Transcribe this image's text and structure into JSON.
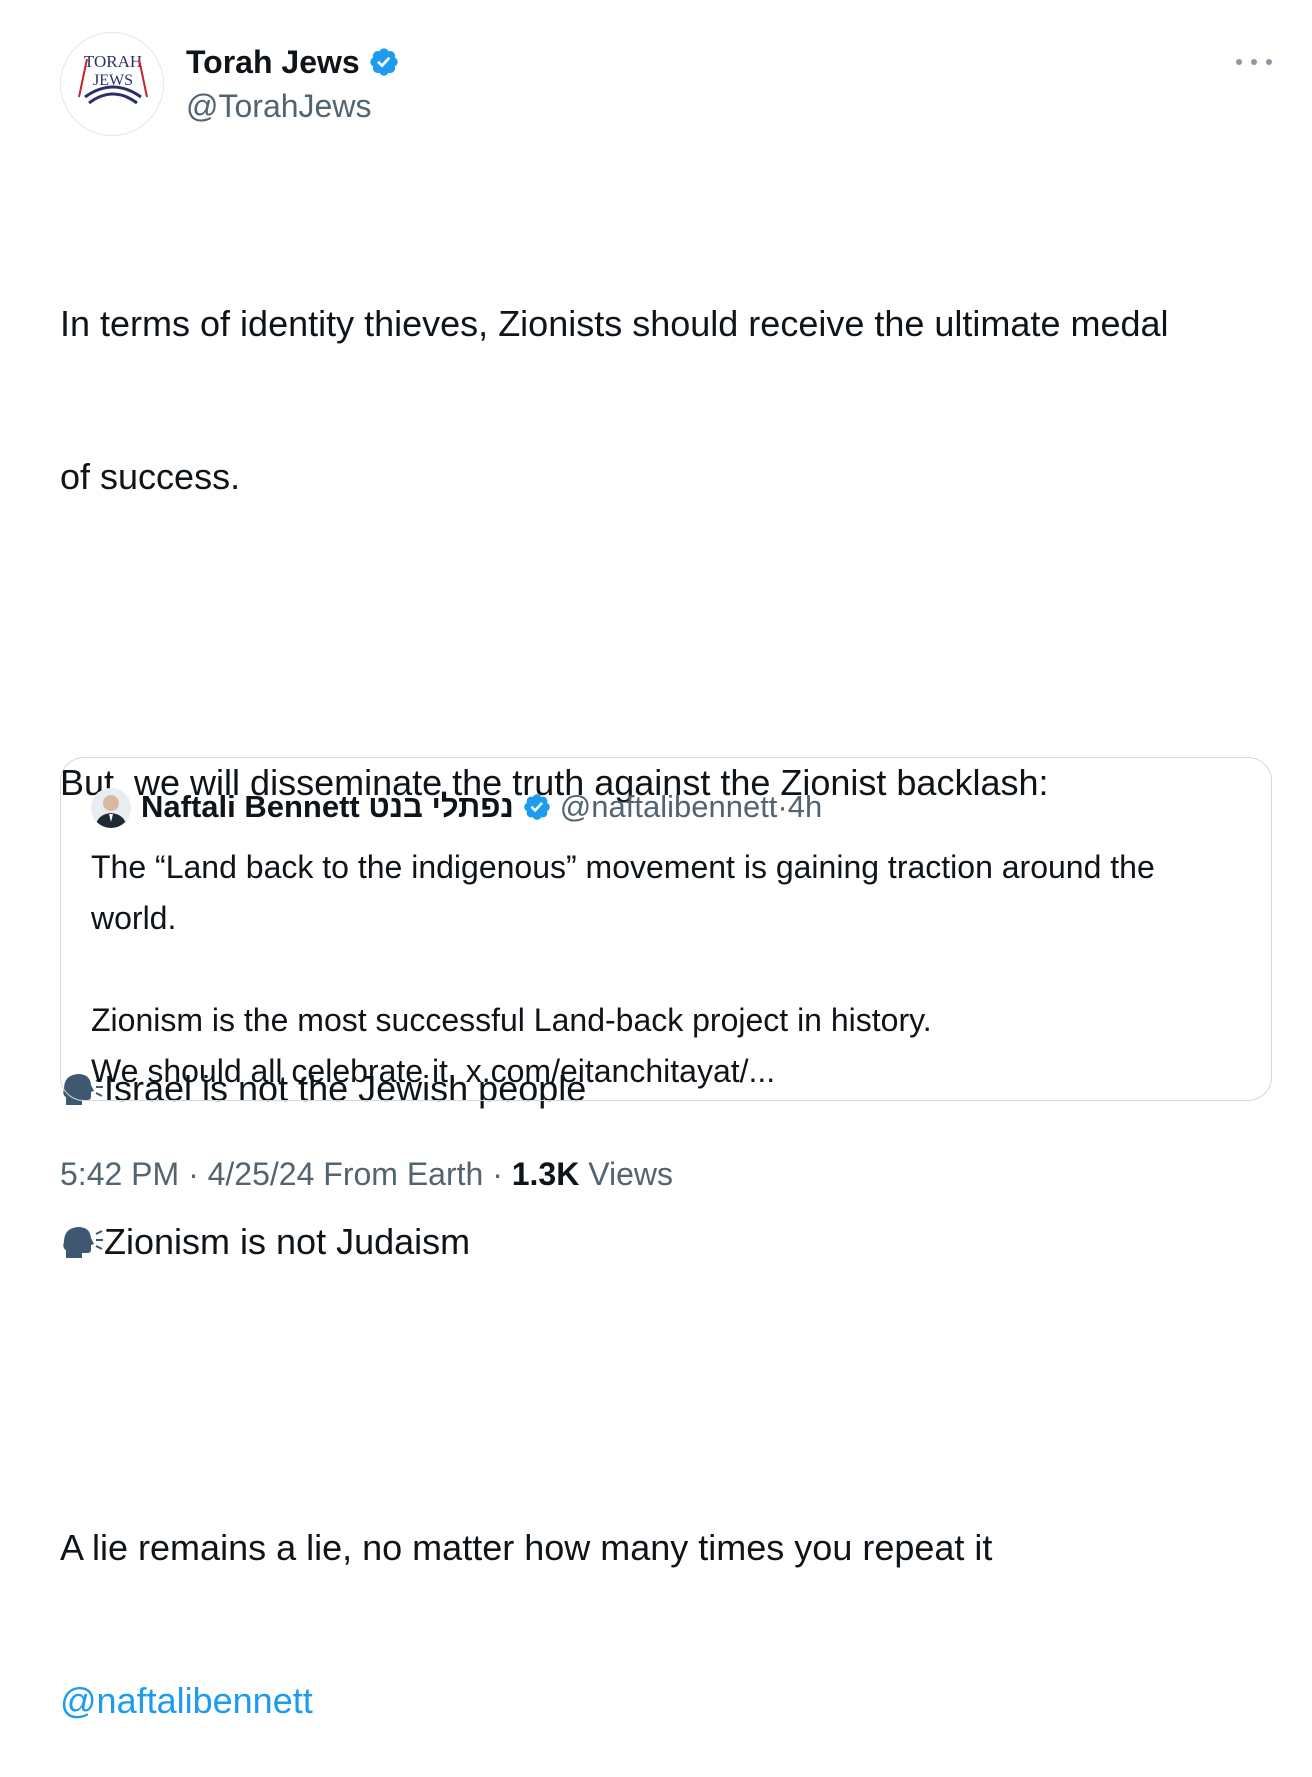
{
  "author": {
    "name": "Torah Jews",
    "handle": "@TorahJews",
    "avatar_lines": [
      "TORAH",
      "JEWS"
    ]
  },
  "tweet": {
    "line1": "In terms of identity thieves, Zionists should receive the ultimate medal",
    "line2": "of success.",
    "line3": "But, we will disseminate the truth against the Zionist backlash:",
    "bullet1": "Israel is not the Jewish people",
    "bullet2": "Zionism is not Judaism",
    "line4": "A lie remains a lie, no matter how many times you repeat it",
    "mention": "@naftalibennett",
    "bullet_icon": "speaking-head-icon"
  },
  "quote": {
    "name": "Naftali Bennett נפתלי בנט",
    "handle": "@naftalibennett",
    "separator": "·",
    "time": "4h",
    "line1": "The “Land back to the indigenous” movement is gaining traction around the",
    "line2": "world.",
    "line3": "Zionism is the most successful Land-back project in history.",
    "line4": "We should all celebrate it. x.com/eitanchitayat/..."
  },
  "meta": {
    "time": "5:42 PM",
    "sep1": "·",
    "date": "4/25/24",
    "source": "From Earth",
    "sep2": "·",
    "views_count": "1.3K",
    "views_label": "Views"
  },
  "colors": {
    "accent": "#1d9bf0",
    "secondary_text": "#536471",
    "border": "#cfd9de"
  }
}
